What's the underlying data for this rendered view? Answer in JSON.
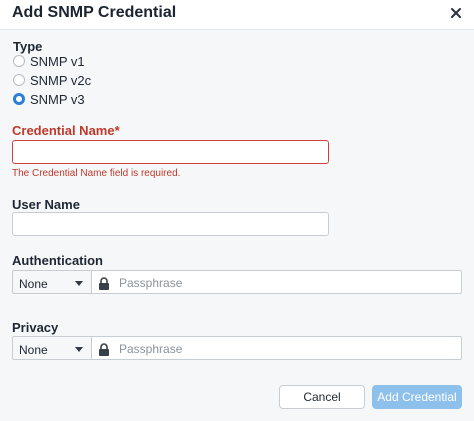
{
  "dialog": {
    "title": "Add SNMP Credential",
    "close_icon": "close-icon"
  },
  "type": {
    "label": "Type",
    "options": [
      "SNMP v1",
      "SNMP v2c",
      "SNMP v3"
    ],
    "selected": "SNMP v3"
  },
  "credential_name": {
    "label": "Credential Name",
    "required_marker": "*",
    "value": "",
    "error": "The Credential Name field is required."
  },
  "user_name": {
    "label": "User Name",
    "value": ""
  },
  "authentication": {
    "label": "Authentication",
    "selected": "None",
    "passphrase_placeholder": "Passphrase",
    "lock_icon": "lock-icon"
  },
  "privacy": {
    "label": "Privacy",
    "selected": "None",
    "passphrase_placeholder": "Passphrase",
    "lock_icon": "lock-icon"
  },
  "buttons": {
    "cancel": "Cancel",
    "submit": "Add Credential"
  },
  "colors": {
    "accent": "#2d7fd6",
    "error": "#c0392b",
    "disabled_primary": "#8ec0ec"
  }
}
